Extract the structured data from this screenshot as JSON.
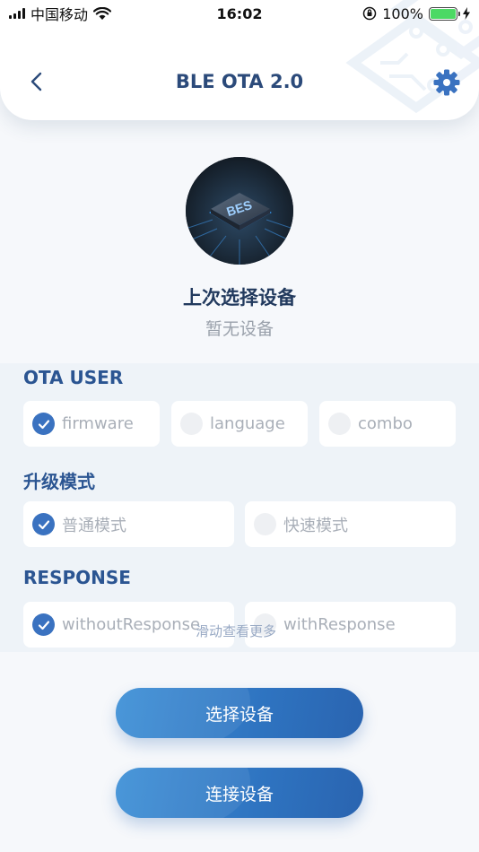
{
  "status": {
    "carrier": "中国移动",
    "time": "16:02",
    "battery": "100%"
  },
  "header": {
    "title": "BLE OTA 2.0"
  },
  "device": {
    "chip_label": "BES",
    "last_title": "上次选择设备",
    "last_value": "暂无设备"
  },
  "options": {
    "ota_user": {
      "title": "OTA USER",
      "items": [
        {
          "label": "firmware",
          "checked": true
        },
        {
          "label": "language",
          "checked": false
        },
        {
          "label": "combo",
          "checked": false
        }
      ]
    },
    "upgrade_mode": {
      "title": "升级模式",
      "items": [
        {
          "label": "普通模式",
          "checked": true
        },
        {
          "label": "快速模式",
          "checked": false
        }
      ]
    },
    "response": {
      "title": "RESPONSE",
      "items": [
        {
          "label": "withoutResponse",
          "checked": true
        },
        {
          "label": "withResponse",
          "checked": false
        }
      ]
    },
    "scroll_hint": "滑动查看更多"
  },
  "actions": {
    "select_device": "选择设备",
    "connect_device": "连接设备"
  },
  "colors": {
    "accent": "#3a72c0",
    "title": "#2b4a7a",
    "panel": "#eef3f8"
  }
}
